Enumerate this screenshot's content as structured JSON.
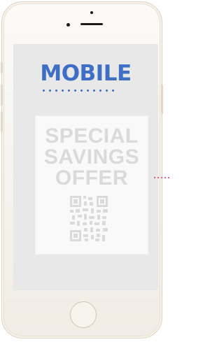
{
  "screen": {
    "title": "MOBILE",
    "title_color": "#3f6fc4"
  },
  "coupon": {
    "lines": [
      "SPECIAL",
      "SAVINGS",
      "OFFER"
    ],
    "text_color": "#dadada",
    "qr_icon": "qr-code-icon"
  },
  "device": {
    "frame_color": "#ddd3c1",
    "screen_color": "#e8e8e8",
    "pointer_color": "#d6306f"
  }
}
